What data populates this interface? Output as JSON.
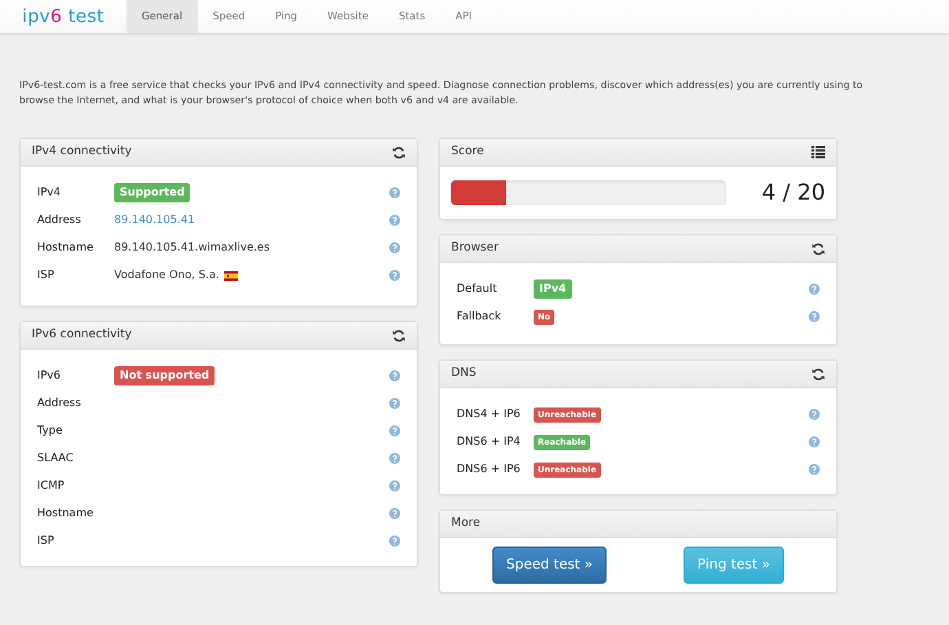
{
  "logo": {
    "part_1": "ipv6",
    "part_2": "test"
  },
  "tabs": [
    {
      "label": "General",
      "selected": true
    },
    {
      "label": "Speed",
      "selected": false
    },
    {
      "label": "Ping",
      "selected": false
    },
    {
      "label": "Website",
      "selected": false
    },
    {
      "label": "Stats",
      "selected": false
    },
    {
      "label": "API",
      "selected": false
    }
  ],
  "intro": "IPv6-test.com is a free service that checks your IPv6 and IPv4 connectivity and speed. Diagnose connection problems, discover which address(es) you are currently using to browse the Internet, and what is your browser's protocol of choice when both v6 and v4 are available.",
  "ipv4": {
    "title": "IPv4 connectivity",
    "rows": [
      {
        "label": "IPv4",
        "kind": "badge",
        "value": "Supported",
        "color": "#5cb85c"
      },
      {
        "label": "Address",
        "kind": "link",
        "value": "89.140.105.41"
      },
      {
        "label": "Hostname",
        "kind": "text",
        "value": "89.140.105.41.wimaxlive.es"
      },
      {
        "label": "ISP",
        "kind": "flag",
        "value": "Vodafone Ono, S.a."
      }
    ]
  },
  "ipv6": {
    "title": "IPv6 connectivity",
    "rows": [
      {
        "label": "IPv6",
        "kind": "badge",
        "value": "Not supported",
        "color": "#d9534f"
      },
      {
        "label": "Address",
        "kind": "empty"
      },
      {
        "label": "Type",
        "kind": "empty"
      },
      {
        "label": "SLAAC",
        "kind": "empty"
      },
      {
        "label": "ICMP",
        "kind": "empty"
      },
      {
        "label": "Hostname",
        "kind": "empty"
      },
      {
        "label": "ISP",
        "kind": "empty"
      }
    ]
  },
  "score": {
    "title": "Score",
    "level": 0.2,
    "reading": "4 / 20"
  },
  "browser": {
    "title": "Browser",
    "rows": [
      {
        "label": "Default",
        "kind": "badge",
        "value": "IPv4",
        "color": "#5cb85c"
      },
      {
        "label": "Fallback",
        "kind": "small",
        "value": "No",
        "color": "#d9534f"
      }
    ]
  },
  "dns": {
    "title": "DNS",
    "rows": [
      {
        "label": "DNS4 + IP6",
        "kind": "small",
        "value": "Unreachable",
        "color": "#d9534f"
      },
      {
        "label": "DNS6 + IP4",
        "kind": "small",
        "value": "Reachable",
        "color": "#5cb85c"
      },
      {
        "label": "DNS6 + IP6",
        "kind": "small",
        "value": "Unreachable",
        "color": "#d9534f"
      }
    ]
  },
  "more": {
    "title": "More",
    "buttons": [
      {
        "label": "Speed test »",
        "kind": "primary"
      },
      {
        "label": "Ping test »",
        "kind": "info"
      }
    ]
  }
}
